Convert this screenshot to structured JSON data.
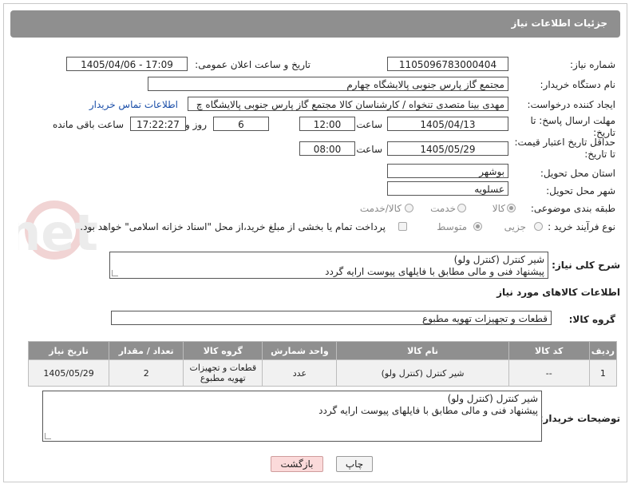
{
  "header": {
    "title": "جزئیات اطلاعات نیاز"
  },
  "fields": {
    "need_number_label": "شماره نیاز:",
    "need_number": "1105096783000404",
    "announce_label": "تاریخ و ساعت اعلان عمومی:",
    "announce_value": "1405/04/06 - 17:09",
    "buyer_org_label": "نام دستگاه خریدار:",
    "buyer_org": "مجتمع گاز پارس جنوبی  پالایشگاه چهارم",
    "creator_label": "ایجاد کننده درخواست:",
    "creator": "مهدی بینا متصدی تنخواه / کارشناسان کالا مجتمع گاز پارس جنوبی  پالایشگاه چ",
    "contact_link": "اطلاعات تماس خریدار",
    "deadline_label_1": "مهلت ارسال پاسخ: تا",
    "deadline_label_2": "تاریخ:",
    "deadline_date": "1405/04/13",
    "time_label": "ساعت",
    "deadline_time": "12:00",
    "days_value": "6",
    "days_label": "روز و",
    "remaining_time": "17:22:27",
    "remaining_label": "ساعت باقی مانده",
    "validity_label_1": "حداقل تاریخ اعتبار قیمت:",
    "validity_label_2": "تا تاریخ:",
    "validity_date": "1405/05/29",
    "validity_time_label": "ساعت",
    "validity_time": "08:00",
    "province_label": "استان محل تحویل:",
    "province": "بوشهر",
    "city_label": "شهر محل تحویل:",
    "city": "عسلویه",
    "category_label": "طبقه بندی موضوعی:",
    "category_options": [
      "کالا",
      "خدمت",
      "کالا/خدمت"
    ],
    "process_label": "نوع فرآیند خرید :",
    "process_options": [
      "جزیی",
      "متوسط"
    ],
    "payment_note": "پرداخت تمام یا بخشی از مبلغ خرید،از محل \"اسناد خزانه اسلامی\" خواهد بود."
  },
  "description": {
    "label": "شرح کلی نیاز:",
    "line1": "شیر کنترل (کنترل ولو)",
    "line2": "پیشنهاد فنی و مالی مطابق با فایلهای پیوست ارایه گردد"
  },
  "goods_section": {
    "title": "اطلاعات کالاهای مورد نیاز",
    "group_label": "گروه کالا:",
    "group_value": "قطعات و تجهیزات تهویه مطبوع"
  },
  "table": {
    "headers": [
      "ردیف",
      "کد کالا",
      "نام کالا",
      "واحد شمارش",
      "گروه کالا",
      "تعداد / مقدار",
      "تاریخ نیاز"
    ],
    "rows": [
      [
        "1",
        "--",
        "شیر کنترل (کنترل ولو)",
        "عدد",
        "قطعات و تجهیزات تهویه مطبوع",
        "2",
        "1405/05/29"
      ]
    ]
  },
  "buyer_notes": {
    "label": "توضیحات خریدار:",
    "line1": "شیر کنترل (کنترل ولو)",
    "line2": "پیشنهاد فنی و مالی مطابق با فایلهای پیوست ارایه گردد"
  },
  "buttons": {
    "print": "چاپ",
    "back": "بازگشت"
  },
  "watermark": "AriaTender.net",
  "colors": {
    "header_bg": "#8f8f8f",
    "link": "#1a4ea8",
    "back_button": "#fbdada"
  }
}
